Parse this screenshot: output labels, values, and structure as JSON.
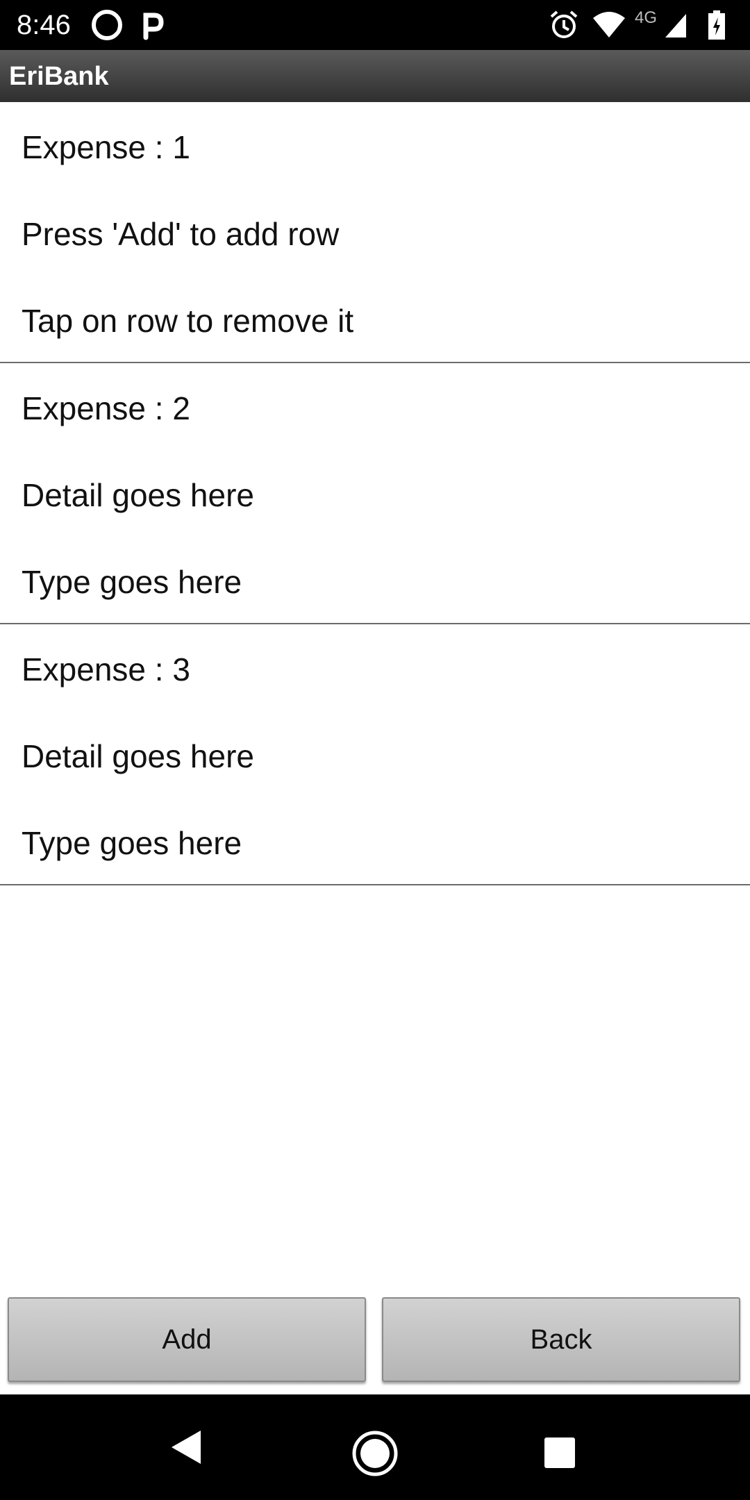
{
  "status_bar": {
    "time": "8:46",
    "network_label": "4G",
    "icons": [
      "sync-app-icon",
      "parking-app-icon",
      "alarm-icon",
      "wifi-icon",
      "cell-signal-icon",
      "battery-charging-icon"
    ]
  },
  "app": {
    "title": "EriBank"
  },
  "expenses": [
    {
      "title": "Expense : 1",
      "line2": "Press 'Add' to add row",
      "line3": "Tap on row to remove it"
    },
    {
      "title": "Expense : 2",
      "line2": "Detail goes here",
      "line3": "Type goes here"
    },
    {
      "title": "Expense : 3",
      "line2": "Detail goes here",
      "line3": "Type goes here"
    }
  ],
  "buttons": {
    "add_label": "Add",
    "back_label": "Back"
  },
  "nav_bar": {
    "icons": [
      "back-nav-icon",
      "home-nav-icon",
      "recents-nav-icon"
    ]
  }
}
